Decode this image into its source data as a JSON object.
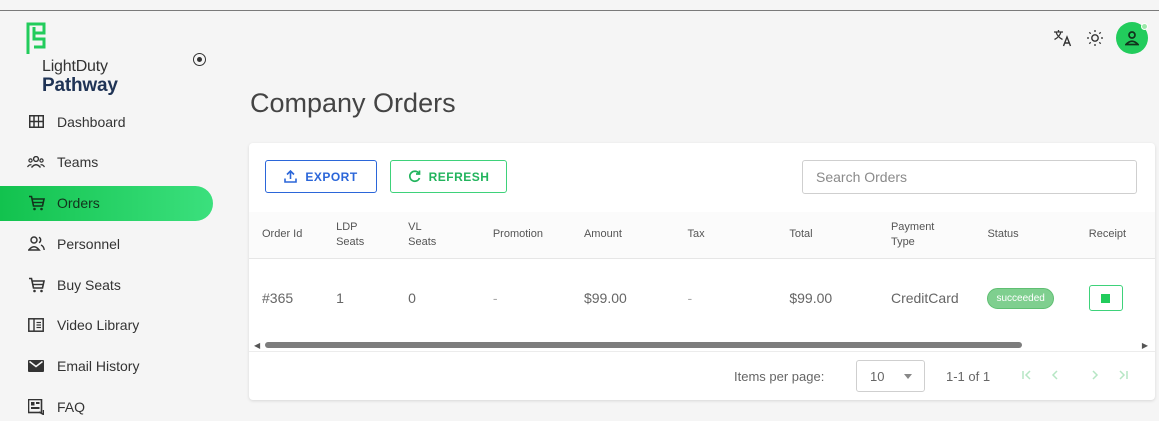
{
  "brand": {
    "line1": "LightDuty",
    "line2": "Pathway",
    "accent": "#22cc5c"
  },
  "nav": [
    {
      "label": "Dashboard",
      "icon": "dashboard-grid-icon",
      "active": false
    },
    {
      "label": "Teams",
      "icon": "teams-icon",
      "active": false
    },
    {
      "label": "Orders",
      "icon": "cart-icon",
      "active": true
    },
    {
      "label": "Personnel",
      "icon": "personnel-icon",
      "active": false
    },
    {
      "label": "Buy Seats",
      "icon": "cart-icon",
      "active": false
    },
    {
      "label": "Video Library",
      "icon": "video-library-icon",
      "active": false
    },
    {
      "label": "Email History",
      "icon": "mail-icon",
      "active": false
    },
    {
      "label": "FAQ",
      "icon": "faq-icon",
      "active": false
    }
  ],
  "header": {
    "icons": [
      "translate-icon",
      "theme-sun-icon",
      "user-avatar-icon"
    ]
  },
  "page": {
    "title": "Company Orders"
  },
  "toolbar": {
    "export_label": "EXPORT",
    "refresh_label": "REFRESH",
    "search_placeholder": "Search Orders"
  },
  "table": {
    "columns": [
      [
        "Order Id"
      ],
      [
        "LDP",
        "Seats"
      ],
      [
        "VL",
        "Seats"
      ],
      [
        "Promotion"
      ],
      [
        "Amount"
      ],
      [
        "Tax"
      ],
      [
        "Total"
      ],
      [
        "Payment",
        "Type"
      ],
      [
        "Status"
      ],
      [
        "Receipt"
      ]
    ],
    "rows": [
      {
        "order_id": "#365",
        "ldp_seats": "1",
        "vl_seats": "0",
        "promotion": "-",
        "amount": "$99.00",
        "tax": "-",
        "total": "$99.00",
        "payment_type": "CreditCard",
        "status": "succeeded"
      }
    ]
  },
  "pagination": {
    "items_per_page_label": "Items per page:",
    "items_per_page": "10",
    "range": "1-1 of 1"
  }
}
